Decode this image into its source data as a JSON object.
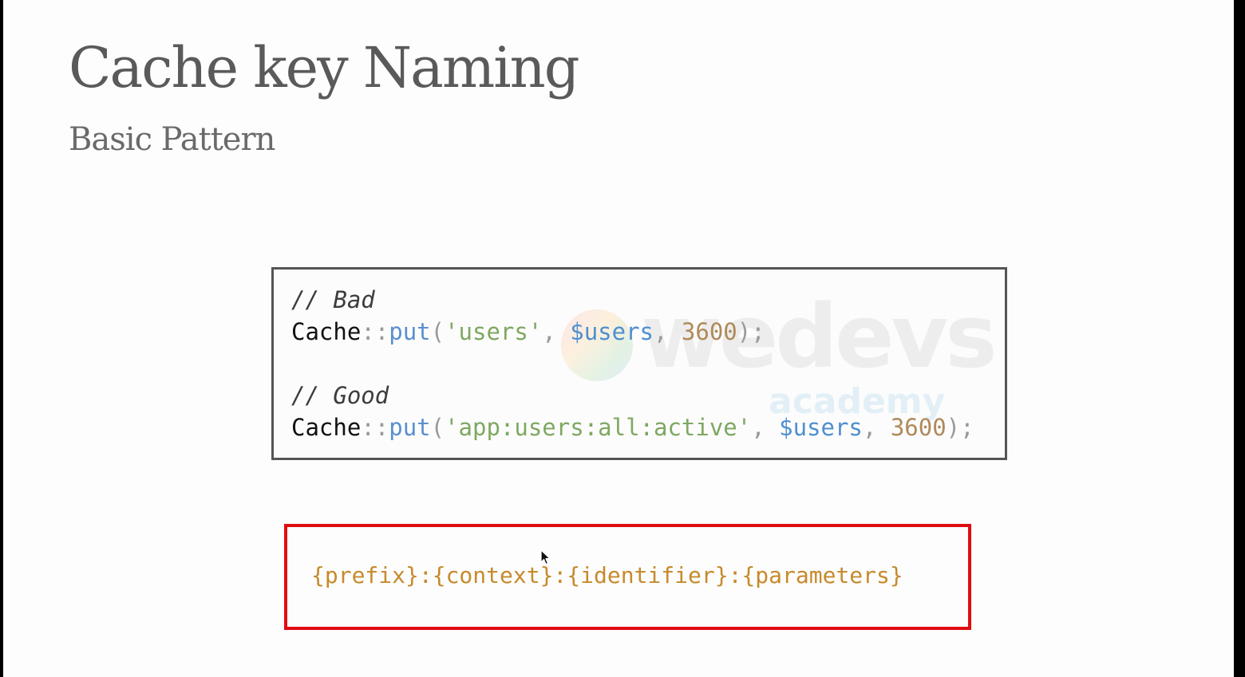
{
  "slide": {
    "title": "Cache key Naming",
    "subtitle": "Basic Pattern"
  },
  "code": {
    "bad_comment": "// Bad",
    "bad_line": {
      "class": "Cache",
      "op": "::",
      "fn": "put",
      "open": "(",
      "key": "'users'",
      "sep1": ", ",
      "var": "$users",
      "sep2": ", ",
      "num": "3600",
      "close": ");"
    },
    "good_comment": "// Good",
    "good_line": {
      "class": "Cache",
      "op": "::",
      "fn": "put",
      "open": "(",
      "key": "'app:users:all:active'",
      "sep1": ", ",
      "var": "$users",
      "sep2": ", ",
      "num": "3600",
      "close": ");"
    },
    "watermark": {
      "brand": "wedevs",
      "sub": "academy"
    }
  },
  "pattern": {
    "text": "{prefix}:{context}:{identifier}:{parameters}",
    "border_color": "#e00d10",
    "text_color": "#c78a2c"
  },
  "icons": {
    "cursor": "mouse-pointer-icon"
  }
}
